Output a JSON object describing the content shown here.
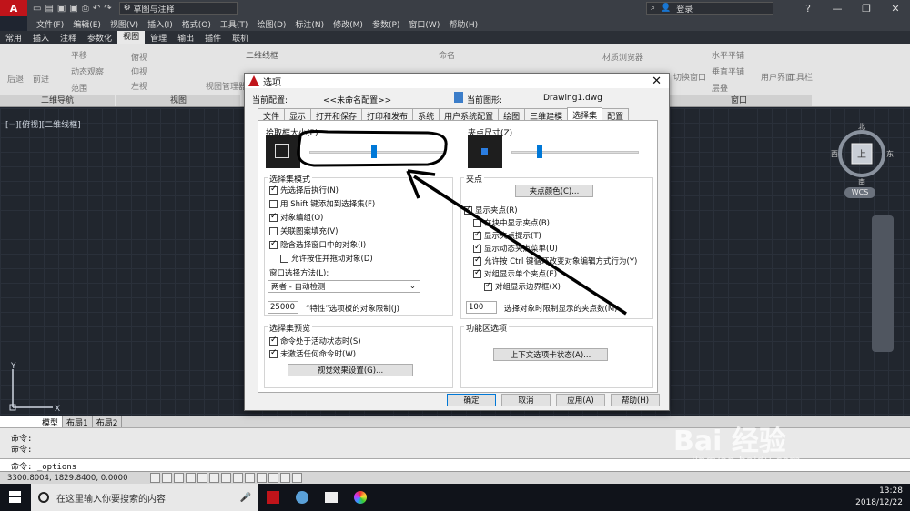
{
  "titlebar": {
    "app_logo": "A",
    "workspace": "草图与注释",
    "login": "登录",
    "help": "?",
    "window_controls": [
      "—",
      "❐",
      "✕"
    ]
  },
  "menu": [
    "文件(F)",
    "编辑(E)",
    "视图(V)",
    "插入(I)",
    "格式(O)",
    "工具(T)",
    "绘图(D)",
    "标注(N)",
    "修改(M)",
    "参数(P)",
    "窗口(W)",
    "帮助(H)"
  ],
  "ribbon_tabs": [
    "常用",
    "插入",
    "注释",
    "参数化",
    "视图",
    "管理",
    "输出",
    "插件",
    "联机"
  ],
  "ribbon": {
    "nav_back": "后退",
    "nav_forward": "前进",
    "pan": "平移",
    "orbit": "动态观察",
    "range": "范围",
    "view_top": "俯视",
    "view_front": "仰视",
    "view_left": "左视",
    "view_manager": "视图管理器",
    "visual_style": "二维线框",
    "right_items": [
      "水平平铺",
      "垂直平铺",
      "层叠",
      "切换窗口",
      "用户界面",
      "工具栏",
      "材质浏览器",
      "命名"
    ],
    "group_nav": "二维导航",
    "group_view": "视图",
    "group_window": "窗口"
  },
  "viewport": {
    "label": "[−][俯视][二维线框]",
    "compass": {
      "north": "北",
      "south": "南",
      "east": "东",
      "west": "西",
      "top": "上"
    },
    "wcs": "WCS",
    "ucs_y": "Y",
    "ucs_x": "X"
  },
  "layout_tabs": [
    "模型",
    "布局1",
    "布局2"
  ],
  "command": {
    "line1": "命令:",
    "line2": "命令:",
    "line3": "命令: _options"
  },
  "status": {
    "coords": "3300.8004, 1829.8400, 0.0000"
  },
  "taskbar": {
    "search_placeholder": "在这里输入你要搜索的内容",
    "time": "13:28",
    "date": "2018/12/22"
  },
  "watermark": {
    "text": "Bai 经验",
    "sub": "jingyan.baidu.com"
  },
  "dialog": {
    "title": "选项",
    "close": "✕",
    "profile_label": "当前配置:",
    "profile_value": "<<未命名配置>>",
    "drawing_label": "当前图形:",
    "drawing_value": "Drawing1.dwg",
    "tabs": [
      "文件",
      "显示",
      "打开和保存",
      "打印和发布",
      "系统",
      "用户系统配置",
      "绘图",
      "三维建模",
      "选择集",
      "配置"
    ],
    "active_tab": "选择集",
    "pickbox_title": "拾取框大小(P)",
    "grip_size_title": "夹点尺寸(Z)",
    "selection_modes_title": "选择集模式",
    "selection_modes": [
      {
        "label": "先选择后执行(N)",
        "checked": true
      },
      {
        "label": "用 Shift 键添加到选择集(F)",
        "checked": false
      },
      {
        "label": "对象编组(O)",
        "checked": true
      },
      {
        "label": "关联图案填充(V)",
        "checked": false
      },
      {
        "label": "隐含选择窗口中的对象(I)",
        "checked": true
      },
      {
        "label": "允许按住并拖动对象(D)",
        "checked": false
      }
    ],
    "window_method_label": "窗口选择方法(L):",
    "window_method_value": "两者 - 自动检测",
    "property_limit_value": "25000",
    "property_limit_label": "“特性”选项板的对象限制(J)",
    "grips_title": "夹点",
    "grip_colors_button": "夹点颜色(C)...",
    "grip_options": [
      {
        "label": "显示夹点(R)",
        "checked": true
      },
      {
        "label": "在块中显示夹点(B)",
        "checked": false
      },
      {
        "label": "显示夹点提示(T)",
        "checked": true
      },
      {
        "label": "显示动态夹点菜单(U)",
        "checked": true
      },
      {
        "label": "允许按 Ctrl 键循环改变对象编辑方式行为(Y)",
        "checked": true
      },
      {
        "label": "对组显示单个夹点(E)",
        "checked": true
      },
      {
        "label": "对组显示边界框(X)",
        "checked": true
      }
    ],
    "grip_limit_value": "100",
    "grip_limit_label": "选择对象时限制显示的夹点数(M)",
    "preview_title": "选择集预览",
    "preview_options": [
      {
        "label": "命令处于活动状态时(S)",
        "checked": true
      },
      {
        "label": "未激活任何命令时(W)",
        "checked": true
      }
    ],
    "visual_effects_button": "视觉效果设置(G)...",
    "ribbon_options_title": "功能区选项",
    "context_tab_button": "上下文选项卡状态(A)...",
    "buttons": {
      "ok": "确定",
      "cancel": "取消",
      "apply": "应用(A)",
      "help": "帮助(H)"
    },
    "pickbox_level": 0.47,
    "grip_size_level": 0.22
  },
  "colors": {
    "accent": "#0078d7",
    "viewport_bg": "#21262e",
    "autocad_red": "#c0141a"
  }
}
